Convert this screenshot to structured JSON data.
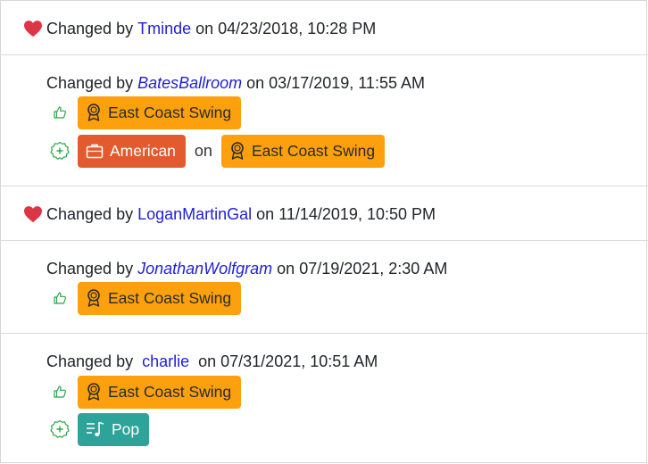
{
  "entries": [
    {
      "prefix": "Changed by",
      "user": "Tminde",
      "middle": "on",
      "datetime": "04/23/2018, 10:28 PM",
      "icon": "heart-icon"
    },
    {
      "prefix": "Changed by",
      "user": "BatesBallroom",
      "middle": "on",
      "datetime": "03/17/2019, 11:55 AM",
      "like_tag": "East Coast Swing",
      "add_tag_style": "American",
      "add_on": "on",
      "add_tag_dance": "East Coast Swing"
    },
    {
      "prefix": "Changed by",
      "user": "LoganMartinGal",
      "middle": "on",
      "datetime": "11/14/2019, 10:50 PM",
      "icon": "heart-icon"
    },
    {
      "prefix": "Changed by",
      "user": "JonathanWolfgram",
      "middle": "on",
      "datetime": "07/19/2021, 2:30 AM",
      "like_tag": "East Coast Swing"
    },
    {
      "prefix": "Changed by",
      "user": "charlie",
      "middle": "on",
      "datetime": "07/31/2021, 10:51 AM",
      "like_tag": "East Coast Swing",
      "add_tag_music": "Pop"
    }
  ],
  "colors": {
    "link": "#1f1fd6",
    "heart": "#dc3545",
    "dance_tag": "#fca10d",
    "style_tag": "#e25a2e",
    "music_tag": "#2da39a",
    "action_icon": "#28a745"
  }
}
